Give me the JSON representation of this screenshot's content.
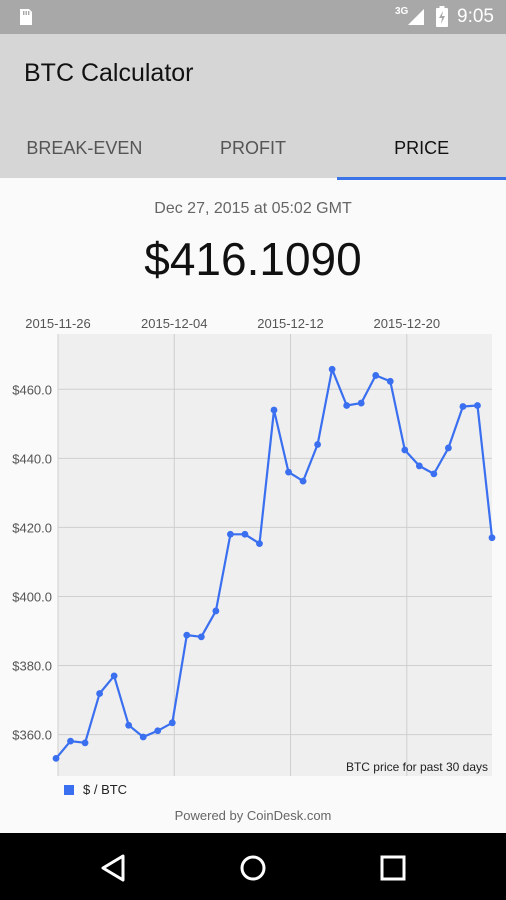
{
  "status_bar": {
    "network": "3G",
    "time": "9:05",
    "icons": [
      "sd-card-icon",
      "signal-icon",
      "battery-charging-icon"
    ]
  },
  "app": {
    "title": "BTC Calculator"
  },
  "tabs": [
    {
      "label": "BREAK-EVEN",
      "active": false
    },
    {
      "label": "PROFIT",
      "active": false
    },
    {
      "label": "PRICE",
      "active": true
    }
  ],
  "price_panel": {
    "timestamp": "Dec 27, 2015 at 05:02 GMT",
    "price": "$416.1090"
  },
  "chart_data": {
    "type": "line",
    "x_tick_labels": [
      "2015-11-26",
      "2015-12-04",
      "2015-12-12",
      "2015-12-20"
    ],
    "y_tick_labels": [
      "$360.0",
      "$380.0",
      "$400.0",
      "$420.0",
      "$440.0",
      "$460.0"
    ],
    "ylim": [
      348,
      476
    ],
    "grid": true,
    "annotation": "BTC price for past 30 days",
    "series": [
      {
        "name": "$ / BTC",
        "color": "#3a6ff0",
        "x": [
          "2015-11-26",
          "2015-11-27",
          "2015-11-28",
          "2015-11-29",
          "2015-11-30",
          "2015-12-01",
          "2015-12-02",
          "2015-12-03",
          "2015-12-04",
          "2015-12-05",
          "2015-12-06",
          "2015-12-07",
          "2015-12-08",
          "2015-12-09",
          "2015-12-10",
          "2015-12-11",
          "2015-12-12",
          "2015-12-13",
          "2015-12-14",
          "2015-12-15",
          "2015-12-16",
          "2015-12-17",
          "2015-12-18",
          "2015-12-19",
          "2015-12-20",
          "2015-12-21",
          "2015-12-22",
          "2015-12-23",
          "2015-12-24",
          "2015-12-25",
          "2015-12-26"
        ],
        "values": [
          353.1,
          358.1,
          357.6,
          371.9,
          377.0,
          362.7,
          359.3,
          361.1,
          363.4,
          388.8,
          388.3,
          395.8,
          418.0,
          418.0,
          415.3,
          454.0,
          436.0,
          433.4,
          444.0,
          465.8,
          455.3,
          456.0,
          464.0,
          462.3,
          442.4,
          437.8,
          435.5,
          443.0,
          455.0,
          455.3,
          417.0
        ]
      }
    ]
  },
  "legend": {
    "label": "$ / BTC"
  },
  "footer": {
    "powered_by": "Powered by CoinDesk.com"
  },
  "nav": {
    "buttons": [
      "back-icon",
      "home-icon",
      "recents-icon"
    ]
  }
}
